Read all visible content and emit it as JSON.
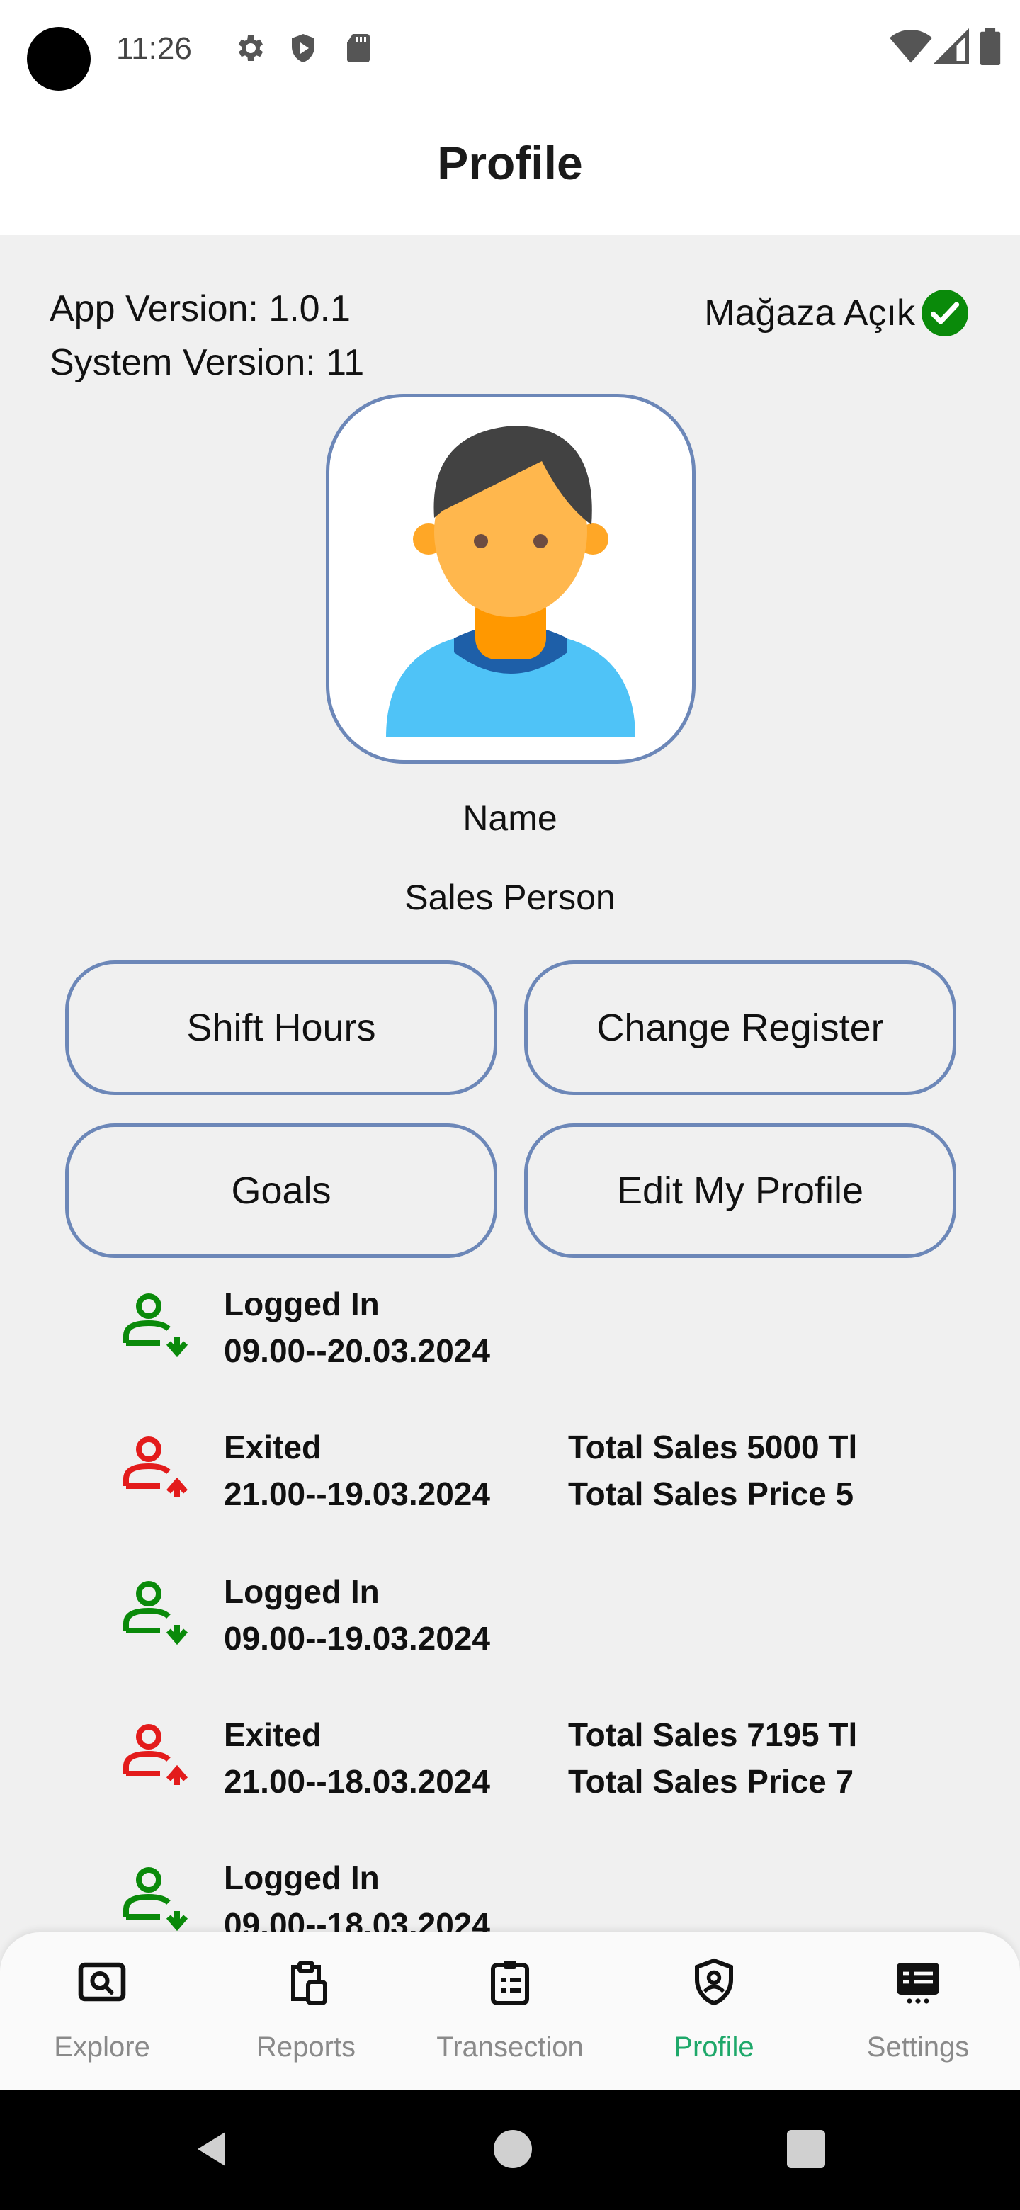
{
  "status_bar": {
    "time": "11:26",
    "icons": [
      "gear-icon",
      "shield-icon",
      "sd-card-icon",
      "wifi-icon",
      "signal-icon",
      "battery-icon"
    ]
  },
  "header": {
    "title": "Profile"
  },
  "info": {
    "app_version": "App Version: 1.0.1",
    "system_version": "System Version: 11",
    "store_status": "Mağaza Açık",
    "store_status_color": "#0a8a0a"
  },
  "profile": {
    "name": "Name",
    "role": "Sales Person"
  },
  "actions": {
    "shift_hours": "Shift Hours",
    "change_register": "Change Register",
    "goals": "Goals",
    "edit_profile": "Edit My Profile"
  },
  "logs": [
    {
      "type": "login",
      "status": "Logged In",
      "time": "09.00--20.03.2024",
      "sales": "",
      "price": ""
    },
    {
      "type": "exit",
      "status": "Exited",
      "time": "21.00--19.03.2024",
      "sales": "Total Sales 5000 Tl",
      "price": "Total Sales Price 5"
    },
    {
      "type": "login",
      "status": "Logged In",
      "time": "09.00--19.03.2024",
      "sales": "",
      "price": ""
    },
    {
      "type": "exit",
      "status": "Exited",
      "time": "21.00--18.03.2024",
      "sales": "Total Sales 7195 Tl",
      "price": "Total Sales Price 7"
    },
    {
      "type": "login",
      "status": "Logged In",
      "time": "09.00--18.03.2024",
      "sales": "",
      "price": ""
    }
  ],
  "colors": {
    "login": "#0a8a0a",
    "exit": "#e31b1b",
    "accent": "#1ea86a",
    "border": "#6c87b8"
  },
  "nav": [
    {
      "label": "Explore",
      "icon": "explore-icon",
      "active": false
    },
    {
      "label": "Reports",
      "icon": "reports-icon",
      "active": false
    },
    {
      "label": "Transection",
      "icon": "transaction-icon",
      "active": false
    },
    {
      "label": "Profile",
      "icon": "profile-shield-icon",
      "active": true
    },
    {
      "label": "Settings",
      "icon": "settings-icon",
      "active": false
    }
  ]
}
